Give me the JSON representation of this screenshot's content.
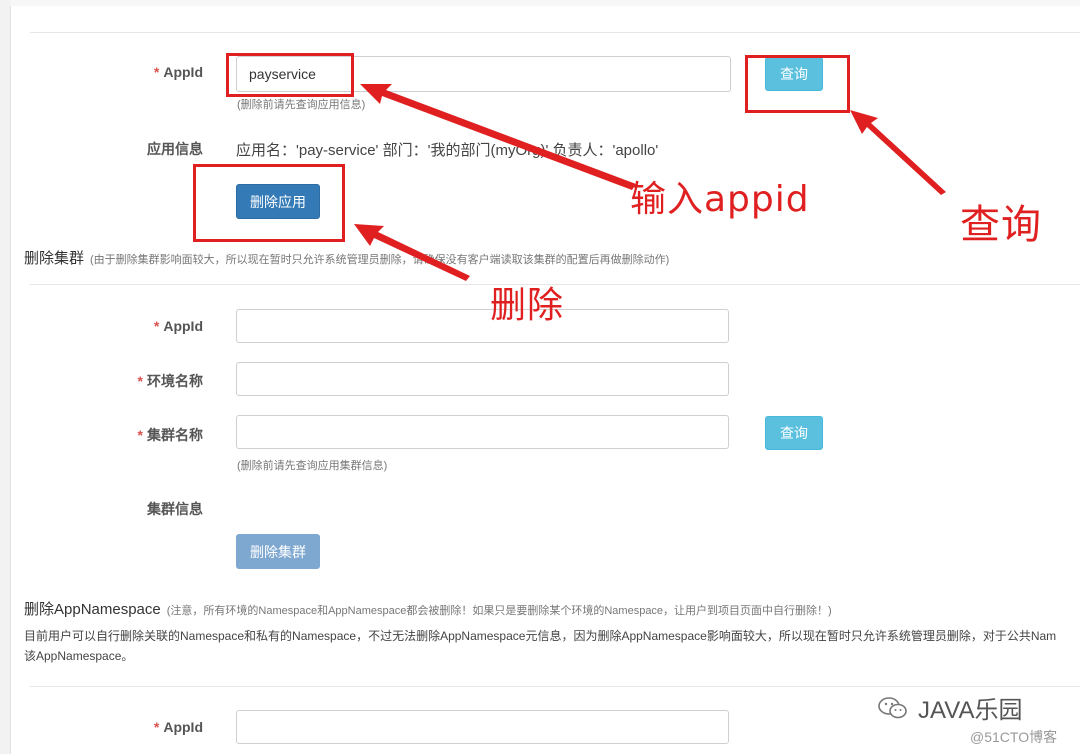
{
  "delete_app": {
    "appid_label": "AppId",
    "appid_value": "payservice",
    "appid_hint": "(删除前请先查询应用信息)",
    "query_button": "查询",
    "app_info_label": "应用信息",
    "app_info_value": "应用名：'pay-service' 部门：'我的部门(myOrg)' 负责人：'apollo'",
    "delete_button": "删除应用"
  },
  "delete_cluster": {
    "title": "删除集群",
    "note": "(由于删除集群影响面较大，所以现在暂时只允许系统管理员删除，请确保没有客户端读取该集群的配置后再做删除动作)",
    "appid_label": "AppId",
    "env_label": "环境名称",
    "cluster_label": "集群名称",
    "query_button": "查询",
    "cluster_hint": "(删除前请先查询应用集群信息)",
    "cluster_info_label": "集群信息",
    "delete_button": "删除集群"
  },
  "delete_namespace": {
    "title": "删除AppNamespace",
    "note": "(注意，所有环境的Namespace和AppNamespace都会被删除！如果只是要删除某个环境的Namespace，让用户到项目页面中自行删除！)",
    "desc_line1": "目前用户可以自行删除关联的Namespace和私有的Namespace，不过无法删除AppNamespace元信息，因为删除AppNamespace影响面较大，所以现在暂时只允许系统管理员删除，对于公共Nam",
    "desc_line2": "该AppNamespace。",
    "appid_label": "AppId"
  },
  "annotations": {
    "input_appid": "输入appid",
    "query": "查询",
    "delete": "删除"
  },
  "watermark": {
    "brand": "JAVA乐园",
    "credit": "@51CTO博客"
  },
  "colors": {
    "annotation_red": "#e02020",
    "query_button": "#5bc0de",
    "primary_button": "#337ab7",
    "required_star": "#d9534f"
  }
}
